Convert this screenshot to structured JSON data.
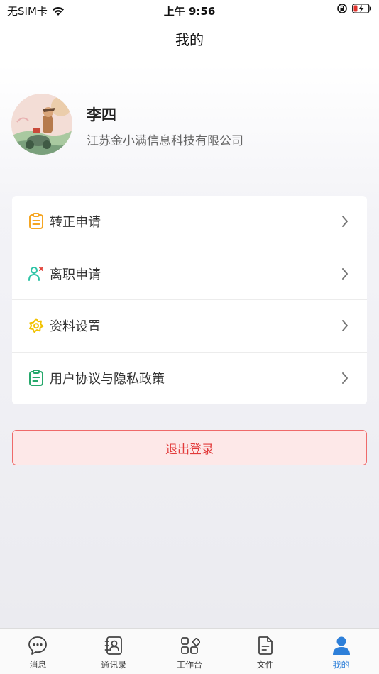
{
  "status_bar": {
    "carrier": "无SIM卡",
    "time": "上午 9:56"
  },
  "nav": {
    "title": "我的"
  },
  "profile": {
    "name": "李四",
    "company": "江苏金小满信息科技有限公司"
  },
  "menu": [
    {
      "label": "转正申请",
      "icon": "clipboard-icon",
      "color": "#f5a623"
    },
    {
      "label": "离职申请",
      "icon": "user-remove-icon",
      "color": "#2ec4a6"
    },
    {
      "label": "资料设置",
      "icon": "flower-settings-icon",
      "color": "#f2c200"
    },
    {
      "label": "用户协议与隐私政策",
      "icon": "document-icon",
      "color": "#25a86b"
    }
  ],
  "logout": {
    "label": "退出登录"
  },
  "tabs": [
    {
      "label": "消息",
      "icon": "chat-bubble-icon"
    },
    {
      "label": "通讯录",
      "icon": "contacts-icon"
    },
    {
      "label": "工作台",
      "icon": "workbench-icon"
    },
    {
      "label": "文件",
      "icon": "file-icon"
    },
    {
      "label": "我的",
      "icon": "person-icon",
      "active": true
    }
  ],
  "colors": {
    "accent": "#2d7fd9",
    "danger": "#e23b3b"
  }
}
